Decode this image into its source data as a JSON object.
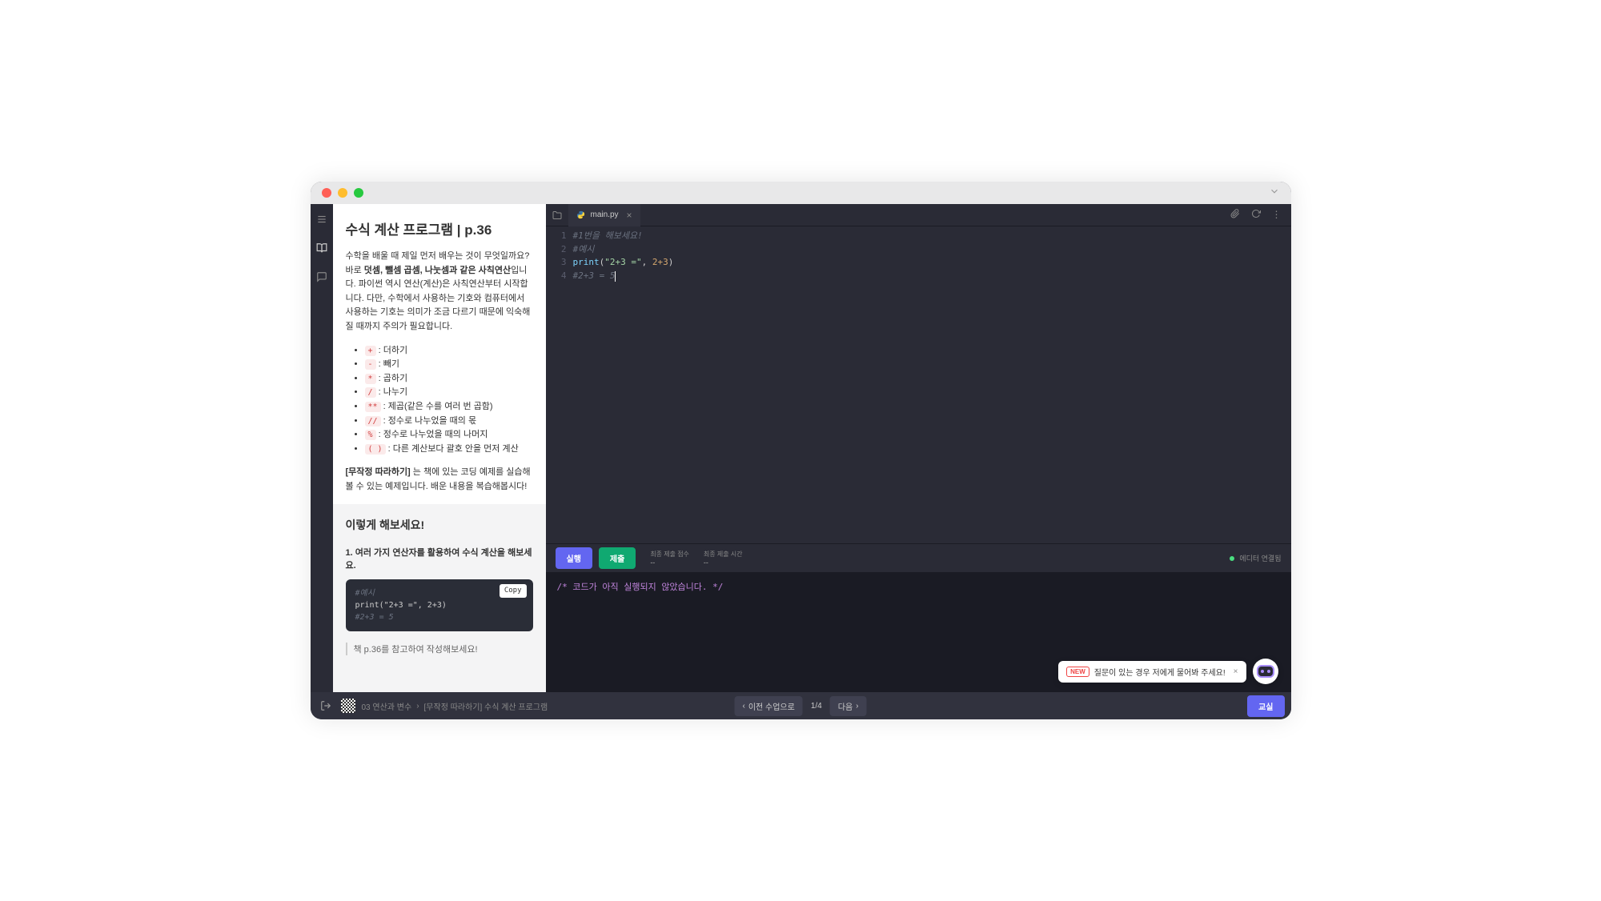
{
  "content": {
    "title": "수식 계산 프로그램 | p.36",
    "intro_p1": "수학을 배울 때 제일 먼저 배우는 것이 무엇일까요? 바로 ",
    "intro_bold": "덧셈, 뺄셈 곱셈, 나눗셈과 같은 사칙연산",
    "intro_p2": "입니다. 파이썬 역시 연산(계산)은 사칙연산부터 시작합니다. 다만, 수학에서 사용하는 기호와 컴퓨터에서 사용하는 기호는 의미가 조금 다르기 때문에 익숙해질 때까지 주의가 필요합니다.",
    "operators": [
      {
        "symbol": "+",
        "desc": ": 더하기"
      },
      {
        "symbol": "-",
        "desc": ": 빼기"
      },
      {
        "symbol": "*",
        "desc": ": 곱하기"
      },
      {
        "symbol": "/",
        "desc": ": 나누기"
      },
      {
        "symbol": "**",
        "desc": ": 제곱(같은 수를 여러 번 곱함)"
      },
      {
        "symbol": "//",
        "desc": ": 정수로 나누었을 때의 몫"
      },
      {
        "symbol": "%",
        "desc": ": 정수로 나누었을 때의 나머지"
      },
      {
        "symbol": "( )",
        "desc": ": 다른 계산보다 괄호 안을 먼저 계산"
      }
    ],
    "note_bold": "[무작정 따라하기]",
    "note_text": " 는 책에 있는 코딩 예제를 실습해볼 수 있는 예제입니다. 배운 내용을 복습해봅시다!",
    "try_title": "이렇게 해보세요!",
    "task": "1. 여러 가지 연산자를 활용하여 수식 계산을 해보세요.",
    "example_comment": "#예시",
    "example_code": "print(\"2+3 =\", 2+3)",
    "example_result": "#2+3 = 5",
    "copy_label": "Copy",
    "hint": "책 p.36를 참고하여 작성해보세요!"
  },
  "editor": {
    "filename": "main.py",
    "lines": [
      {
        "n": 1,
        "type": "comment",
        "text": "#1번을 해보세요!"
      },
      {
        "n": 2,
        "type": "comment",
        "text": "#예시"
      },
      {
        "n": 3,
        "type": "print",
        "fn": "print",
        "arg1": "\"2+3 =\"",
        "sep": ", ",
        "arg2": "2+3"
      },
      {
        "n": 4,
        "type": "comment",
        "text": "#2+3 = 5"
      }
    ]
  },
  "runbar": {
    "run": "실행",
    "submit": "제출",
    "score_label": "최종 제출 점수",
    "score_val": "--",
    "time_label": "최종 제출 시간",
    "time_val": "--",
    "status": "에디터 연결됨"
  },
  "output": {
    "message": "/* 코드가 아직 실행되지 않았습니다. */"
  },
  "bottom": {
    "crumb1": "03 연산과 변수",
    "crumb_sep": "›",
    "crumb2": "[무작정 따라하기] 수식 계산 프로그램",
    "prev": "이전 수업으로",
    "page_cur": "1",
    "page_sep": "/",
    "page_total": "4",
    "next": "다음",
    "classroom": "교실"
  },
  "chatbot": {
    "badge": "NEW",
    "message": "질문이 있는 경우 저에게 물어봐 주세요!"
  }
}
